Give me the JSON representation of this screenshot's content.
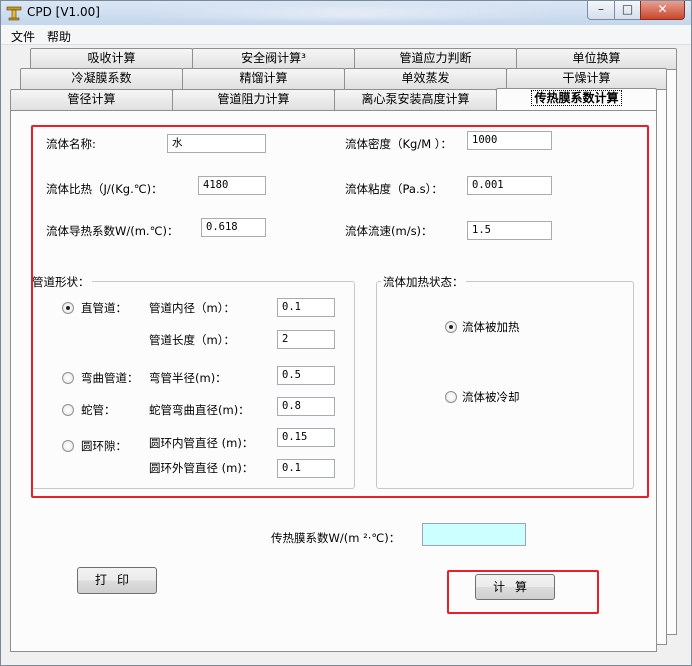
{
  "window": {
    "title": "CPD [V1.00]"
  },
  "menu": [
    "文件",
    "帮助"
  ],
  "tabs": {
    "row1": [
      "吸收计算",
      "安全阀计算³",
      "管道应力判断",
      "单位换算"
    ],
    "row2": [
      "冷凝膜系数",
      "精馏计算",
      "单效蒸发",
      "干燥计算"
    ],
    "row3": [
      "管径计算",
      "管道阻力计算",
      "离心泵安装高度计算",
      "传热膜系数计算"
    ]
  },
  "form": {
    "fluid_name": {
      "label": "流体名称:",
      "value": "水"
    },
    "density": {
      "label": "流体密度（Kg/M ）：",
      "value": "1000"
    },
    "specific_heat": {
      "label": "流体比热（J/(Kg.℃)：",
      "value": "4180"
    },
    "viscosity": {
      "label": "流体粘度（Pa.s）：",
      "value": "0.001"
    },
    "conductivity": {
      "label": "流体导热系数W/(m.℃)：",
      "value": "0.618"
    },
    "velocity": {
      "label": "流体流速(m/s)：",
      "value": "1.5"
    }
  },
  "pipe_shape": {
    "title": "管道形状：",
    "options": [
      "直管道：",
      "弯曲管道：",
      "蛇管：",
      "圆环隙："
    ],
    "selected": "直管道：",
    "inner_diameter": {
      "label": "管道内径（m）：",
      "value": "0.1"
    },
    "length": {
      "label": "管道长度（m）：",
      "value": "2"
    },
    "bend_radius": {
      "label": "弯管半径(m)：",
      "value": "0.5"
    },
    "coil_diameter": {
      "label": "蛇管弯曲直径(m)：",
      "value": "0.8"
    },
    "annulus_inner": {
      "label": "圆环内管直径 (m)：",
      "value": "0.15"
    },
    "annulus_outer": {
      "label": "圆环外管直径 (m)：",
      "value": "0.1"
    }
  },
  "heating_state": {
    "title": "流体加热状态：",
    "options": [
      "流体被加热",
      "流体被冷却"
    ],
    "selected": "流体被加热"
  },
  "result": {
    "label": "传热膜系数W/(m ²·℃)：",
    "value": ""
  },
  "buttons": {
    "print": "打印",
    "compute": "计算"
  },
  "colors": {
    "highlight": "#e8202a",
    "result_bg": "#ccffff"
  }
}
